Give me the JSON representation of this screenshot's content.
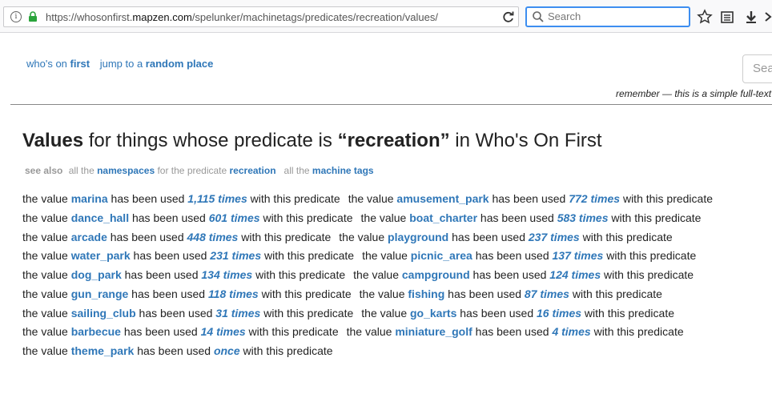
{
  "browser": {
    "url_prefix": "https://whosonfirst.",
    "url_host": "mapzen.com",
    "url_path": "/spelunker/machinetags/predicates/recreation/values/",
    "search_placeholder": "Search"
  },
  "nav": {
    "wof_prefix": "who's on ",
    "wof_bold": "first",
    "jump_prefix": "jump to a ",
    "jump_bold": "random place"
  },
  "site_search": {
    "placeholder": "Sea"
  },
  "remember_text": "remember — this is a simple full-text",
  "title": {
    "part1": "Values",
    "part2": " for things whose predicate is ",
    "part3": "“recreation”",
    "part4": " in Who's On First"
  },
  "see_also": {
    "label": "see also",
    "t1": "all the ",
    "l1": "namespaces",
    "t2": " for the predicate ",
    "l2": "recreation",
    "t3": "all the ",
    "l3": "machine tags"
  },
  "phrase": {
    "pre": "the value ",
    "mid": " has been used ",
    "post": " with this predicate"
  },
  "values": [
    {
      "name": "marina",
      "count": "1,115 times"
    },
    {
      "name": "amusement_park",
      "count": "772 times"
    },
    {
      "name": "dance_hall",
      "count": "601 times"
    },
    {
      "name": "boat_charter",
      "count": "583 times"
    },
    {
      "name": "arcade",
      "count": "448 times"
    },
    {
      "name": "playground",
      "count": "237 times"
    },
    {
      "name": "water_park",
      "count": "231 times"
    },
    {
      "name": "picnic_area",
      "count": "137 times"
    },
    {
      "name": "dog_park",
      "count": "134 times"
    },
    {
      "name": "campground",
      "count": "124 times"
    },
    {
      "name": "gun_range",
      "count": "118 times"
    },
    {
      "name": "fishing",
      "count": "87 times"
    },
    {
      "name": "sailing_club",
      "count": "31 times"
    },
    {
      "name": "go_karts",
      "count": "16 times"
    },
    {
      "name": "barbecue",
      "count": "14 times"
    },
    {
      "name": "miniature_golf",
      "count": "4 times"
    },
    {
      "name": "theme_park",
      "count": "once"
    }
  ]
}
